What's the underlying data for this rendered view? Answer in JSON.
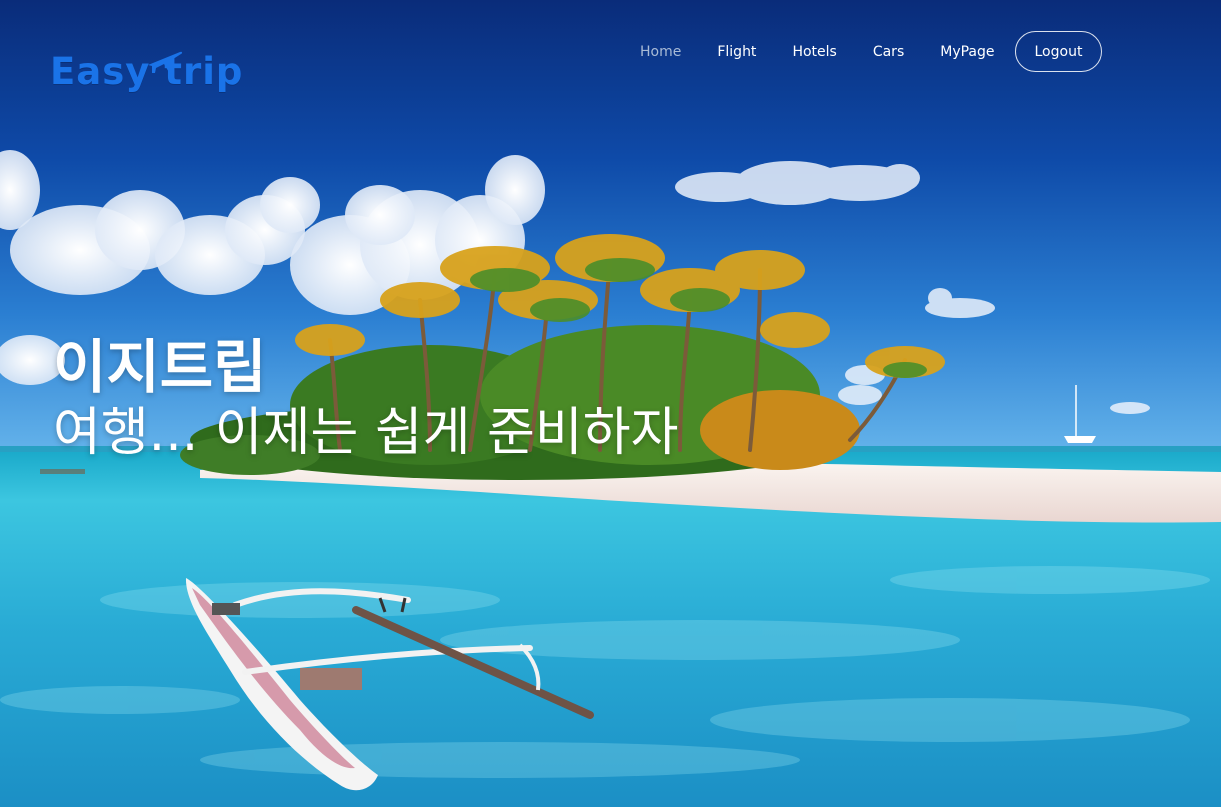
{
  "brand": {
    "name": "Easy trip",
    "logo_icon": "airplane-icon",
    "color": "#1a73e8"
  },
  "nav": {
    "items": [
      {
        "label": "Home",
        "active": true
      },
      {
        "label": "Flight",
        "active": false
      },
      {
        "label": "Hotels",
        "active": false
      },
      {
        "label": "Cars",
        "active": false
      },
      {
        "label": "MyPage",
        "active": false
      }
    ],
    "logout_label": "Logout"
  },
  "hero": {
    "title": "이지트립",
    "subtitle": "여행... 이제는 쉽게 준비하자",
    "background": "tropical-island-lagoon-with-outrigger-canoe"
  },
  "colors": {
    "sky_top": "#0a2f80",
    "sky_bottom": "#2f86d6",
    "water": "#2bb8d8",
    "sand": "#f3e7e2",
    "active_nav": "#a9bbd6"
  }
}
